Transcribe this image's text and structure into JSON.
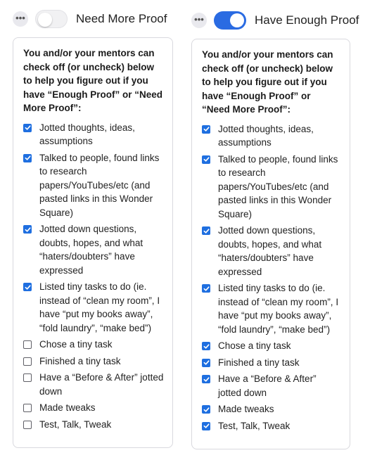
{
  "left": {
    "toggle_label": "Need More Proof",
    "toggle_on": false,
    "intro": "You and/or your mentors can check off (or uncheck) below to help you figure out if you have “Enough Proof” or “Need More Proof”:",
    "items": [
      {
        "label": "Jotted thoughts, ideas, assumptions",
        "checked": true
      },
      {
        "label": "Talked to people, found links to research papers/YouTubes/etc (and pasted links in this Wonder Square)",
        "checked": true
      },
      {
        "label": "Jotted down questions, doubts, hopes, and what “haters/doubters” have expressed",
        "checked": true
      },
      {
        "label": "Listed tiny tasks to do (ie. instead of “clean my room”, I have “put my books away”, “fold laundry”, “make bed”)",
        "checked": true
      },
      {
        "label": "Chose a tiny task",
        "checked": false
      },
      {
        "label": "Finished a tiny task",
        "checked": false
      },
      {
        "label": "Have a “Before & After” jotted down",
        "checked": false
      },
      {
        "label": "Made tweaks",
        "checked": false
      },
      {
        "label": "Test, Talk, Tweak",
        "checked": false
      }
    ]
  },
  "right": {
    "toggle_label": "Have Enough Proof",
    "toggle_on": true,
    "intro": "You and/or your mentors can check off (or uncheck) below to help you figure out if you have “Enough Proof” or “Need More Proof”:",
    "items": [
      {
        "label": "Jotted thoughts, ideas, assumptions",
        "checked": true
      },
      {
        "label": "Talked to people, found links to research papers/YouTubes/etc (and pasted links in this Wonder Square)",
        "checked": true
      },
      {
        "label": "Jotted down questions, doubts, hopes, and what “haters/doubters” have expressed",
        "checked": true
      },
      {
        "label": "Listed tiny tasks to do (ie. instead of “clean my room”, I have “put my books away”, “fold laundry”, “make bed”)",
        "checked": true
      },
      {
        "label": "Chose a tiny task",
        "checked": true
      },
      {
        "label": "Finished a tiny task",
        "checked": true
      },
      {
        "label": "Have a “Before & After” jotted down",
        "checked": true
      },
      {
        "label": "Made tweaks",
        "checked": true
      },
      {
        "label": "Test, Talk, Tweak",
        "checked": true
      }
    ]
  },
  "icons": {
    "more": "more-horizontal-icon",
    "check": "checkmark-icon"
  },
  "colors": {
    "accent": "#1f6fe0",
    "toggle_on": "#2a6be2",
    "toggle_off": "#f1f1f3"
  }
}
